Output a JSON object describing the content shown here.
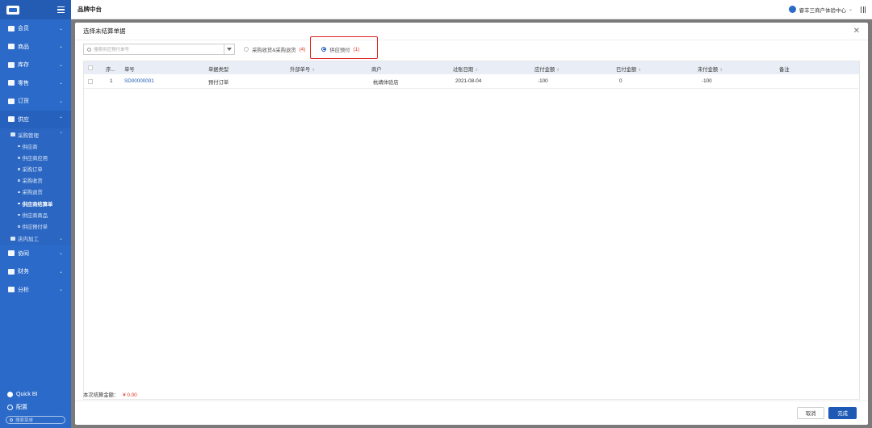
{
  "header": {
    "app_title": "品牌中台",
    "store_name": "睿丰三商户体验中心"
  },
  "sidebar": {
    "items": [
      {
        "label": "会员",
        "icon": "member-icon"
      },
      {
        "label": "商品",
        "icon": "product-icon"
      },
      {
        "label": "库存",
        "icon": "inventory-icon"
      },
      {
        "label": "零售",
        "icon": "retail-icon"
      },
      {
        "label": "订货",
        "icon": "order-icon"
      },
      {
        "label": "供应",
        "icon": "supply-icon"
      }
    ],
    "group_title": "采购管理",
    "sub_items": [
      "供应商",
      "供应商应用",
      "采购订单",
      "采购收货",
      "采购退货",
      "供应商结算单",
      "供应商商品",
      "供应预付单"
    ],
    "current_sub": "供应商结算单",
    "group2_title": "店内加工",
    "items_after": [
      {
        "label": "协同",
        "icon": "collab-icon"
      },
      {
        "label": "财务",
        "icon": "finance-icon"
      },
      {
        "label": "分析",
        "icon": "analysis-icon"
      }
    ],
    "quick_bi": "Quick BI",
    "settings": "配置",
    "search_placeholder": "搜索菜单"
  },
  "modal": {
    "title": "选择未结算单据",
    "search_placeholder": "搜索供应预付单号",
    "option1_label": "采购收货&采购退货",
    "option1_count": "(4)",
    "option2_label": "供应预付",
    "option2_count": "(1)",
    "selected_option": "供应预付"
  },
  "table": {
    "columns": [
      "序...",
      "单号",
      "单据类型",
      "外部单号",
      "商户",
      "过账日期",
      "应付金额",
      "已付金额",
      "未付金额",
      "备注"
    ],
    "rows": [
      {
        "index": "1",
        "doc_no": "SD00000001",
        "doc_type": "预付订单",
        "ext_no": "",
        "merchant": "杭靖体验店",
        "post_date": "2021-08-04",
        "payable": "-100",
        "paid": "0",
        "unpaid": "-100",
        "note": ""
      }
    ]
  },
  "footer": {
    "sum_label": "本次结算金额：",
    "sum_value": "¥ 0.00",
    "cancel_label": "取消",
    "ok_label": "完成"
  },
  "colors": {
    "sidebar": "#2b6ac9",
    "primary": "#1e5ab5",
    "danger": "#e0301e",
    "highlight": "#e02020"
  }
}
